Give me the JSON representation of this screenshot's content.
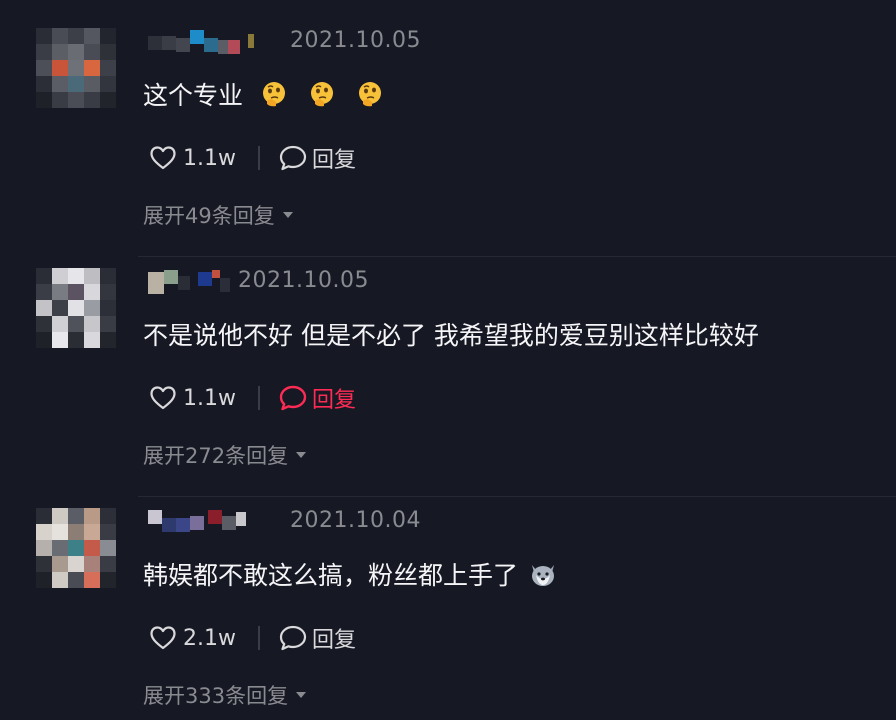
{
  "comments": [
    {
      "date": "2021.10.05",
      "text": "这个专业",
      "emojis": [
        "thinking-face-emoji",
        "thinking-face-emoji",
        "thinking-face-emoji"
      ],
      "likes": "1.1w",
      "reply_label": "回复",
      "reply_active": false,
      "expand_label": "展开49条回复"
    },
    {
      "date": "2021.10.05",
      "text": "不是说他不好 但是不必了 我希望我的爱豆别这样比较好",
      "emojis": [],
      "likes": "1.1w",
      "reply_label": "回复",
      "reply_active": true,
      "expand_label": "展开272条回复"
    },
    {
      "date": "2021.10.04",
      "text": "韩娱都不敢这么搞，粉丝都上手了",
      "emojis": [
        "husky-dog-emoji"
      ],
      "likes": "2.1w",
      "reply_label": "回复",
      "reply_active": false,
      "expand_label": "展开333条回复"
    }
  ],
  "colors": {
    "background": "#161823",
    "accent": "#fe2c55",
    "muted_text": "#8a8b91",
    "primary_text": "#f5f5f7"
  },
  "icons": {
    "like": "heart-outline-icon",
    "reply": "speech-bubble-icon",
    "expand": "caret-down-icon"
  }
}
